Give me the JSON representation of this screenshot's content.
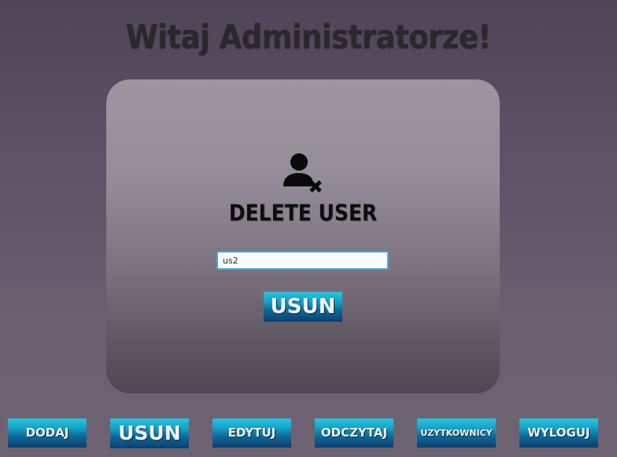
{
  "header": {
    "welcome_text": "Witaj Administratorze!"
  },
  "panel": {
    "icon": "user-remove-icon",
    "title": "DELETE USER",
    "username_input": {
      "value": "us2",
      "placeholder": ""
    },
    "submit_label": "USUN"
  },
  "nav": {
    "items": [
      {
        "label": "DODAJ"
      },
      {
        "label": "USUN"
      },
      {
        "label": "EDYTUJ"
      },
      {
        "label": "ODCZYTAJ"
      },
      {
        "label": "UZYTKOWNICY"
      },
      {
        "label": "WYLOGUJ"
      }
    ]
  },
  "colors": {
    "button_top": "#26c6e0",
    "button_bottom": "#0a3f6f",
    "input_border": "#3fa6d9"
  }
}
